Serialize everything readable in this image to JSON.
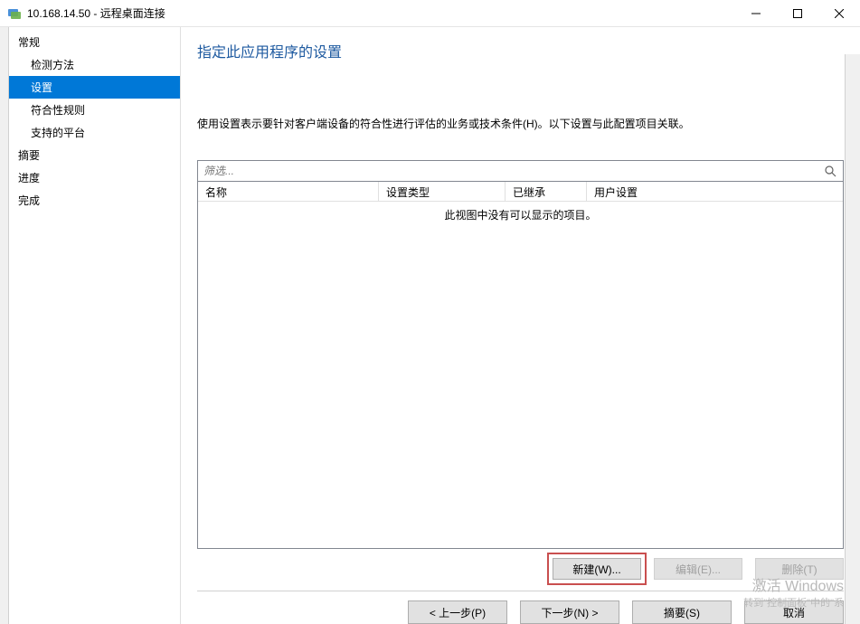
{
  "window": {
    "title": "10.168.14.50 - 远程桌面连接"
  },
  "sidebar": {
    "groups": [
      {
        "label": "常规",
        "items": [
          {
            "label": "检测方法"
          },
          {
            "label": "设置",
            "selected": true
          },
          {
            "label": "符合性规则"
          },
          {
            "label": "支持的平台"
          }
        ]
      },
      {
        "label": "摘要",
        "items": []
      },
      {
        "label": "进度",
        "items": []
      },
      {
        "label": "完成",
        "items": []
      }
    ]
  },
  "content": {
    "title": "指定此应用程序的设置",
    "description": "使用设置表示要针对客户端设备的符合性进行评估的业务或技术条件(H)。以下设置与此配置项目关联。",
    "filter_placeholder": "筛选...",
    "columns": {
      "name": "名称",
      "type": "设置类型",
      "inherited": "已继承",
      "user": "用户设置"
    },
    "empty_message": "此视图中没有可以显示的项目。",
    "buttons": {
      "new": "新建(W)...",
      "edit": "编辑(E)...",
      "delete": "删除(T)"
    },
    "wizard": {
      "prev": "< 上一步(P)",
      "next": "下一步(N) >",
      "summary": "摘要(S)",
      "cancel": "取消"
    }
  },
  "watermark": {
    "line1": "激活 Windows",
    "line2": "转到\"控制面板\"中的\"系"
  }
}
